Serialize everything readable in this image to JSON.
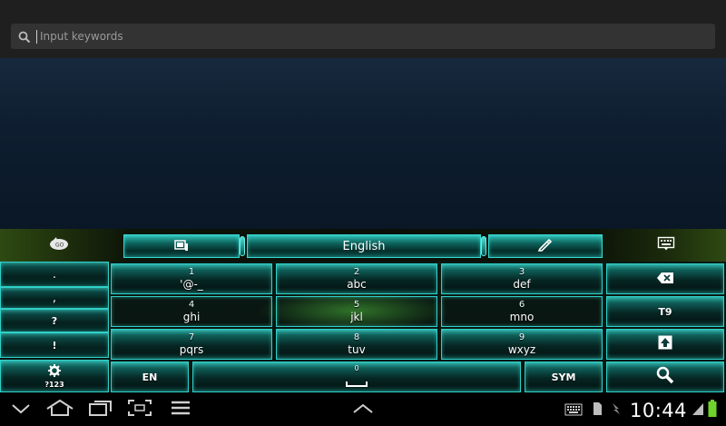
{
  "search": {
    "placeholder": "Input keywords"
  },
  "toolbar": {
    "language_label": "English"
  },
  "keys": {
    "row1": [
      {
        "num": "1",
        "letters": "'@-_"
      },
      {
        "num": "2",
        "letters": "abc"
      },
      {
        "num": "3",
        "letters": "def"
      }
    ],
    "row2": [
      {
        "num": "4",
        "letters": "ghi"
      },
      {
        "num": "5",
        "letters": "jkl"
      },
      {
        "num": "6",
        "letters": "mno"
      }
    ],
    "row3": [
      {
        "num": "7",
        "letters": "pqrs"
      },
      {
        "num": "8",
        "letters": "tuv"
      },
      {
        "num": "9",
        "letters": "wxyz"
      }
    ],
    "punctuation": [
      ".",
      ",",
      "?",
      "!"
    ],
    "t9_label": "T9",
    "symbols_label": "?123",
    "lang_label": "EN",
    "space_num": "0",
    "sym_label": "SYM"
  },
  "status": {
    "time": "10:44"
  },
  "colors": {
    "key_border": "#2fd0c9",
    "key_glow": "#46f0e6",
    "galaxy_green": "#50be3c",
    "wallpaper": "#0e1e30"
  },
  "icons": {
    "search": "search-icon",
    "go_logo": "go-logo-icon",
    "clipboard": "clipboard-icon",
    "handwriting": "pen-icon",
    "keyboard_menu": "keyboard-menu-icon",
    "backspace": "backspace-icon",
    "shift": "shift-icon",
    "settings": "gear-icon",
    "magnifier": "search-icon"
  }
}
